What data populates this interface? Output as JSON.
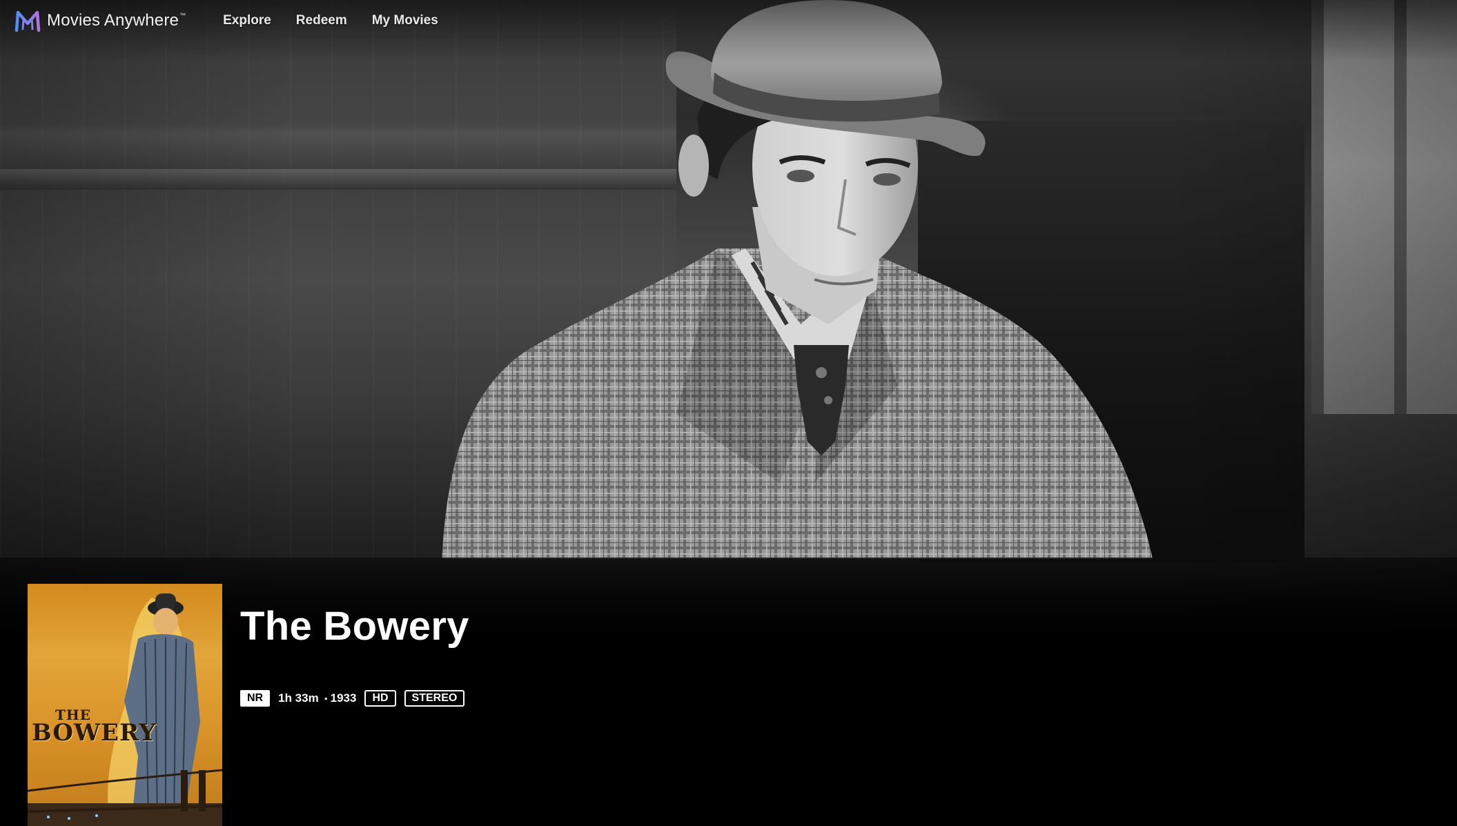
{
  "app": {
    "brand_name": "Movies Anywhere",
    "trademark": "™",
    "logo_icon": "movies-anywhere-logo-icon"
  },
  "nav": {
    "items": [
      {
        "label": "Explore"
      },
      {
        "label": "Redeem"
      },
      {
        "label": "My Movies"
      }
    ]
  },
  "movie": {
    "title": "The Bowery",
    "rating": "NR",
    "runtime": "1h 33m",
    "separator": "•",
    "year": "1933",
    "video_format": "HD",
    "audio_format": "STEREO",
    "poster_title_line1": "THE",
    "poster_title_line2": "BOWERY"
  },
  "colors": {
    "background": "#000000",
    "text": "#ffffff",
    "logo_gradient_start": "#4e8ff0",
    "logo_gradient_end": "#b173e6",
    "poster_orange": "#d99328"
  }
}
